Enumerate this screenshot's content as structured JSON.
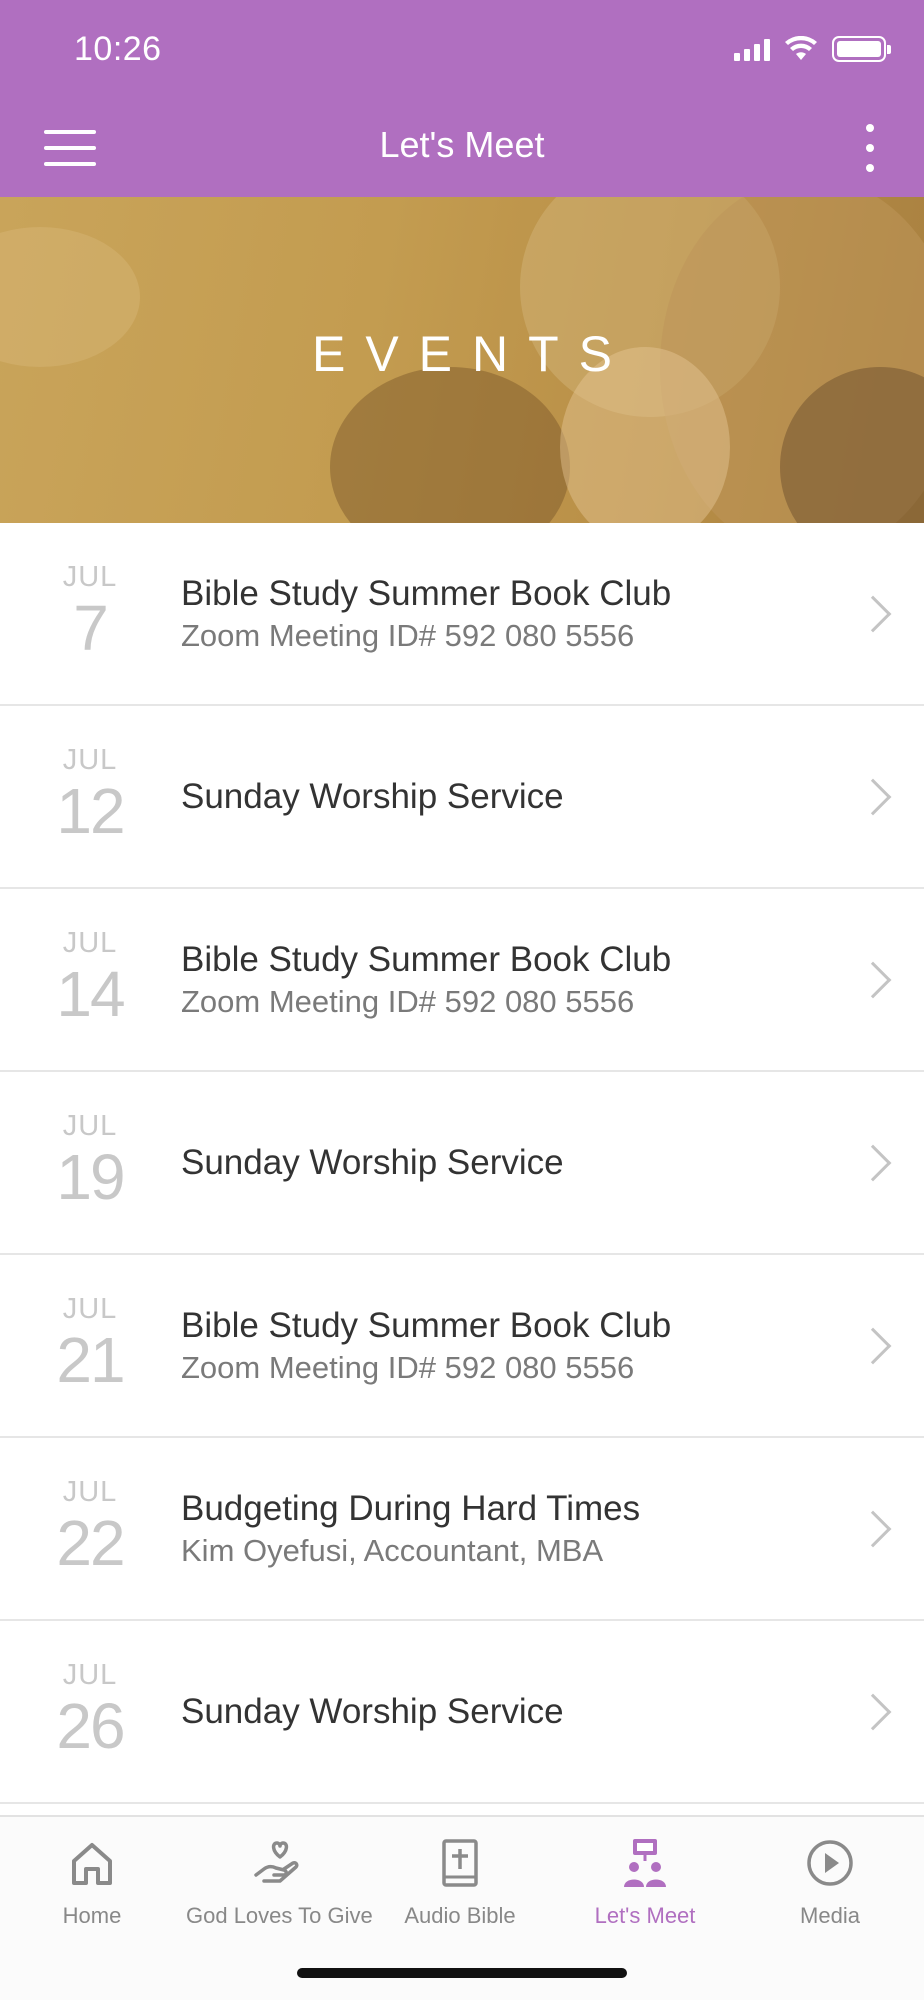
{
  "status": {
    "time": "10:26"
  },
  "nav": {
    "title": "Let's Meet"
  },
  "banner": {
    "title": "EVENTS"
  },
  "events": [
    {
      "month": "JUL",
      "day": "7",
      "title": "Bible Study Summer Book Club",
      "subtitle": "Zoom Meeting ID# 592 080 5556"
    },
    {
      "month": "JUL",
      "day": "12",
      "title": "Sunday Worship Service",
      "subtitle": ""
    },
    {
      "month": "JUL",
      "day": "14",
      "title": "Bible Study Summer Book Club",
      "subtitle": "Zoom Meeting ID# 592 080 5556"
    },
    {
      "month": "JUL",
      "day": "19",
      "title": "Sunday Worship Service",
      "subtitle": ""
    },
    {
      "month": "JUL",
      "day": "21",
      "title": "Bible Study Summer Book Club",
      "subtitle": "Zoom Meeting ID# 592 080 5556"
    },
    {
      "month": "JUL",
      "day": "22",
      "title": "Budgeting During Hard Times",
      "subtitle": "Kim Oyefusi, Accountant, MBA"
    },
    {
      "month": "JUL",
      "day": "26",
      "title": "Sunday Worship Service",
      "subtitle": ""
    }
  ],
  "tabs": [
    {
      "label": "Home",
      "icon": "home-icon",
      "active": false
    },
    {
      "label": "God Loves To Give",
      "icon": "giving-hand-heart-icon",
      "active": false
    },
    {
      "label": "Audio Bible",
      "icon": "bible-icon",
      "active": false
    },
    {
      "label": "Let's Meet",
      "icon": "people-meeting-icon",
      "active": true
    },
    {
      "label": "Media",
      "icon": "play-circle-icon",
      "active": false
    }
  ],
  "colors": {
    "accent": "#b06fc0",
    "banner": "#c39c50",
    "inactive": "#888888"
  }
}
